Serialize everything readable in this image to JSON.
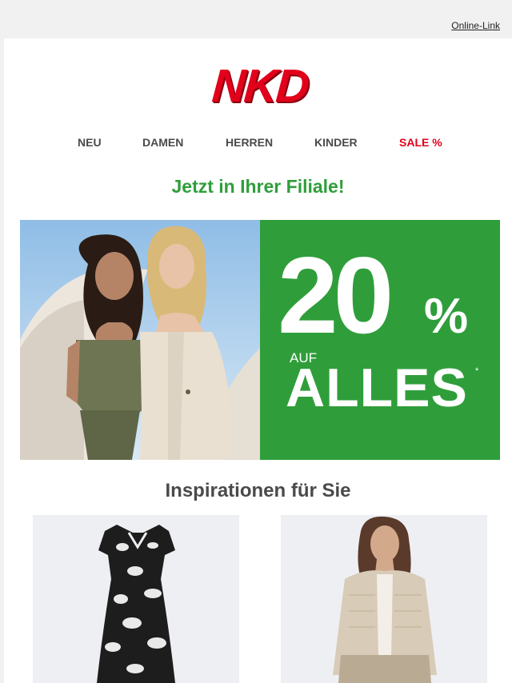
{
  "header": {
    "online_link": "Online-Link"
  },
  "brand": {
    "logo_text": "NKD",
    "logo_color": "#e2001a"
  },
  "nav": {
    "items": [
      {
        "label": "NEU"
      },
      {
        "label": "DAMEN"
      },
      {
        "label": "HERREN"
      },
      {
        "label": "KINDER"
      },
      {
        "label": "SALE %"
      }
    ]
  },
  "headline": "Jetzt in Ihrer Filiale!",
  "hero": {
    "promo_number": "20",
    "promo_percent": "%",
    "promo_auf": "AUF",
    "promo_alles": "ALLES",
    "promo_asterisk": "*",
    "promo_bg_color": "#2f9e3a"
  },
  "inspirations": {
    "title": "Inspirationen für Sie"
  },
  "colors": {
    "accent_green": "#2f9e3a",
    "sale_red": "#e2001a",
    "text_gray": "#4a4a4a"
  }
}
